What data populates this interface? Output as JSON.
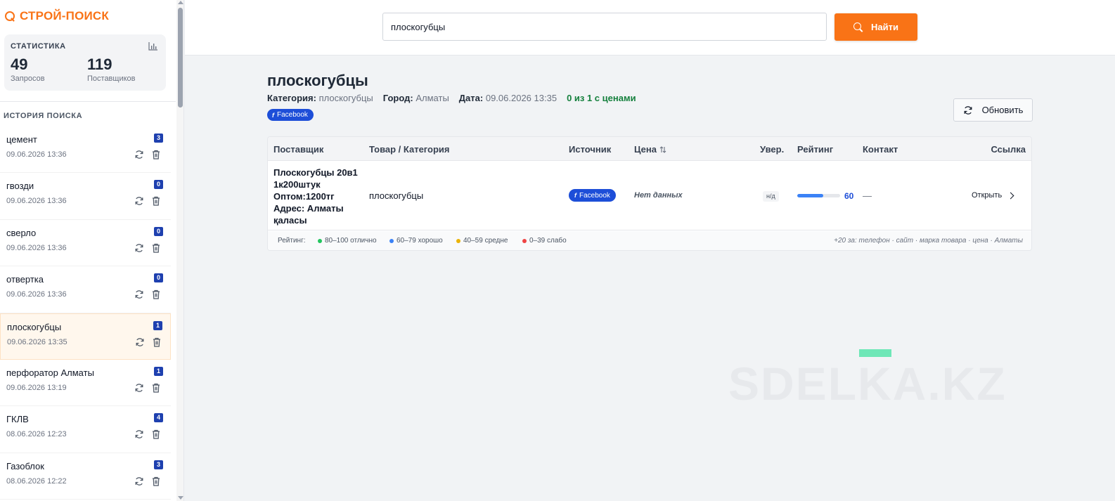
{
  "brand": {
    "name": "СТРОЙ-ПОИСК",
    "icon": "search-icon",
    "color": "#f97316"
  },
  "stats": {
    "title": "СТАТИСТИКА",
    "icon": "bar-chart-icon",
    "requests_value": "49",
    "requests_label": "Запросов",
    "suppliers_value": "119",
    "suppliers_label": "Поставщиков"
  },
  "history": {
    "title": "ИСТОРИЯ ПОИСКА",
    "items": [
      {
        "query": "цемент",
        "date": "09.06.2026 13:36",
        "count": "3"
      },
      {
        "query": "гвозди",
        "date": "09.06.2026 13:36",
        "count": "0"
      },
      {
        "query": "сверло",
        "date": "09.06.2026 13:36",
        "count": "0"
      },
      {
        "query": "отвертка",
        "date": "09.06.2026 13:36",
        "count": "0"
      },
      {
        "query": "плоскогубцы",
        "date": "09.06.2026 13:35",
        "count": "1",
        "active": true
      },
      {
        "query": "перфоратор Алматы",
        "date": "09.06.2026 13:19",
        "count": "1"
      },
      {
        "query": "ГКЛВ",
        "date": "08.06.2026 12:23",
        "count": "4"
      },
      {
        "query": "Газоблок",
        "date": "08.06.2026 12:22",
        "count": "3"
      }
    ]
  },
  "search": {
    "value": "плоскогубцы",
    "button_label": "Найти"
  },
  "results": {
    "title": "плоскогубцы",
    "category_label": "Категория:",
    "category_value": "плоскогубцы",
    "city_label": "Город:",
    "city_value": "Алматы",
    "date_label": "Дата:",
    "date_value": "09.06.2026 13:35",
    "priced_summary": "0 из 1 с ценами",
    "source_tag": "Facebook",
    "refresh_label": "Обновить"
  },
  "table": {
    "headers": {
      "supplier": "Поставщик",
      "product": "Товар / Категория",
      "source": "Источник",
      "price": "Цена",
      "confidence": "Увер.",
      "rating": "Рейтинг",
      "contact": "Контакт",
      "link": "Ссылка"
    },
    "rows": [
      {
        "supplier": "Плоскогубцы 20в1 1к200штук Оптом:1200тг Адрес: Алматы қаласы",
        "category": "плоскогубцы",
        "source": "Facebook",
        "price": "Нет данных",
        "confidence": "н/д",
        "rating": 60,
        "rating_text": "60",
        "contact": "—",
        "link_label": "Открыть"
      }
    ]
  },
  "legend": {
    "label": "Рейтинг:",
    "items": [
      {
        "text": "80–100 отлично",
        "color": "#22c55e"
      },
      {
        "text": "60–79 хорошо",
        "color": "#3b82f6"
      },
      {
        "text": "40–59 средне",
        "color": "#eab308"
      },
      {
        "text": "0–39 слабо",
        "color": "#ef4444"
      }
    ],
    "note": "+20 за: телефон · сайт · марка товара · цена · Алматы"
  },
  "watermark": "SDELKA.KZ"
}
